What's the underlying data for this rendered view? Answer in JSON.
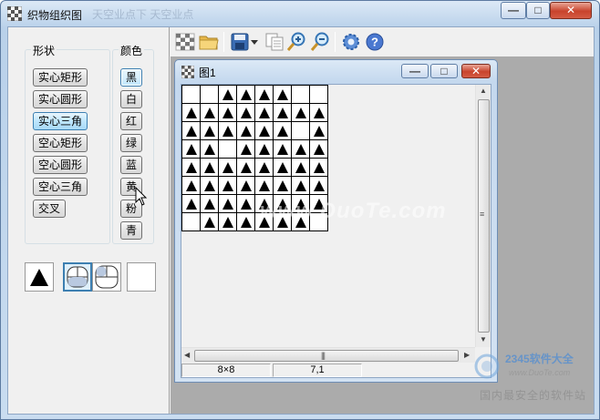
{
  "window": {
    "title": "织物组织图",
    "ghost_text": "天空业点下 天空业点",
    "buttons": {
      "minimize": "—",
      "maximize": "□",
      "close": "✕"
    }
  },
  "left_panel": {
    "shape_group_label": "形状",
    "color_group_label": "颜色",
    "shapes": [
      "实心矩形",
      "实心圆形",
      "实心三角",
      "空心矩形",
      "空心圆形",
      "空心三角",
      "交叉"
    ],
    "selected_shape": "实心三角",
    "colors": [
      "黑",
      "白",
      "红",
      "绿",
      "蓝",
      "黄",
      "粉",
      "青"
    ],
    "selected_color": "黑",
    "hovered_color": "黄"
  },
  "toolbar": {
    "icons": [
      "checker-icon",
      "open-folder-icon",
      "save-icon",
      "dropdown-arrow-icon",
      "copy-icon",
      "zoom-in-icon",
      "zoom-out-icon",
      "settings-icon",
      "help-icon"
    ]
  },
  "child_window": {
    "title": "图1",
    "buttons": {
      "minimize": "—",
      "maximize": "□",
      "close": "✕"
    },
    "pattern": [
      "00111100",
      "11111111",
      "11111101",
      "11011111",
      "11111111",
      "11111111",
      "11111111",
      "01111110"
    ],
    "status": {
      "size": "8×8",
      "position": "7,1"
    }
  },
  "watermarks": {
    "center": "www.DuoTe.com",
    "brand": "2345软件大全",
    "url": "www.DuoTe.com",
    "bottom": "国内最安全的软件站"
  }
}
